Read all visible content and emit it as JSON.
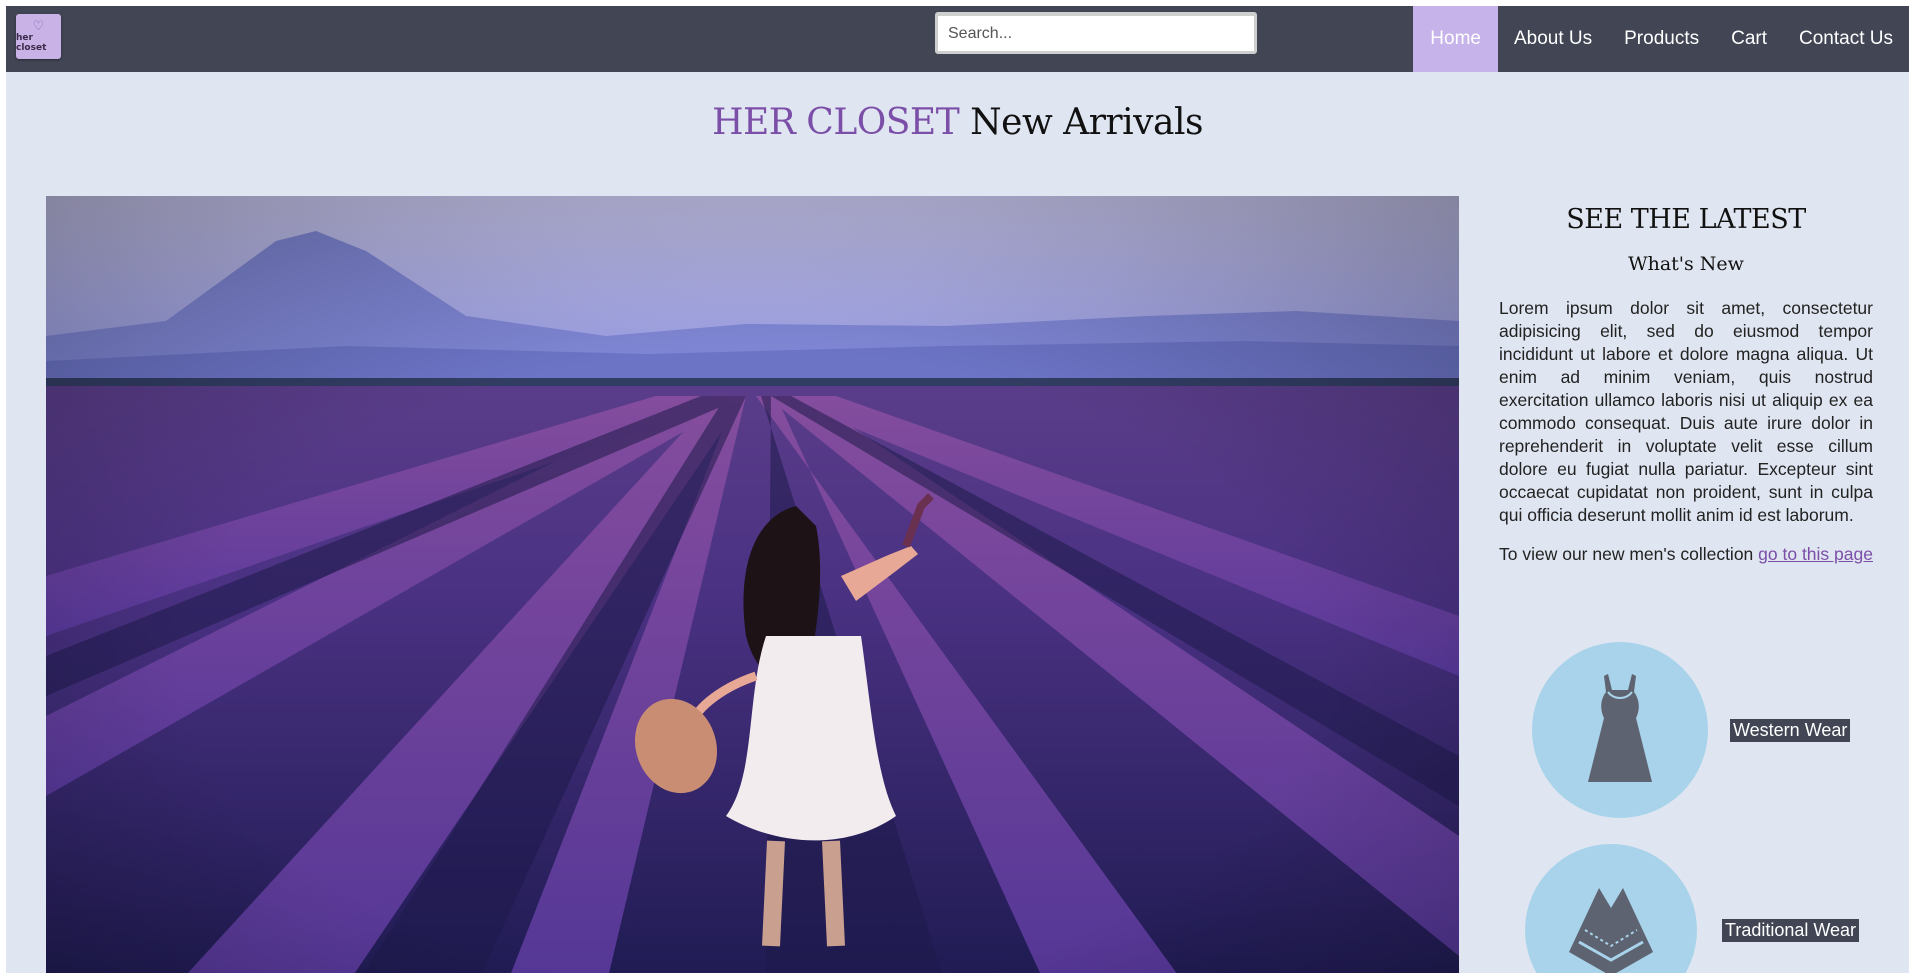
{
  "nav": {
    "logo_text": "her closet",
    "search_placeholder": "Search...",
    "links": [
      "Home",
      "About Us",
      "Products",
      "Cart",
      "Contact Us"
    ],
    "active": "Home"
  },
  "headline": {
    "brand": "HER CLOSET",
    "rest": "New Arrivals"
  },
  "hero": {
    "description": ""
  },
  "sidebar": {
    "title": "SEE THE LATEST",
    "subtitle": "What's New",
    "body": "Lorem ipsum dolor sit amet, consectetur adipisicing elit, sed do eiusmod tempor incididunt ut labore et dolore magna aliqua. Ut enim ad minim veniam, quis nostrud exercitation ullamco laboris nisi ut aliquip ex ea commodo consequat. Duis aute irure dolor in reprehenderit in voluptate velit esse cillum dolore eu fugiat nulla pariatur. Excepteur sint occaecat cupidatat non proident, sunt in culpa qui officia deserunt mollit anim id est laborum.",
    "cta_prefix": "To view our new men's collection ",
    "cta_link": "go to this page",
    "categories": [
      {
        "label": "Western Wear",
        "icon": "dress-icon"
      },
      {
        "label": "Traditional Wear",
        "icon": "poncho-icon"
      }
    ]
  },
  "colors": {
    "navbar": "#414554",
    "active_tab": "#c6b3e9",
    "page_bg": "#e0e6f1",
    "brand_purple": "#7b4ea8",
    "category_circle": "#a8d3ea"
  }
}
